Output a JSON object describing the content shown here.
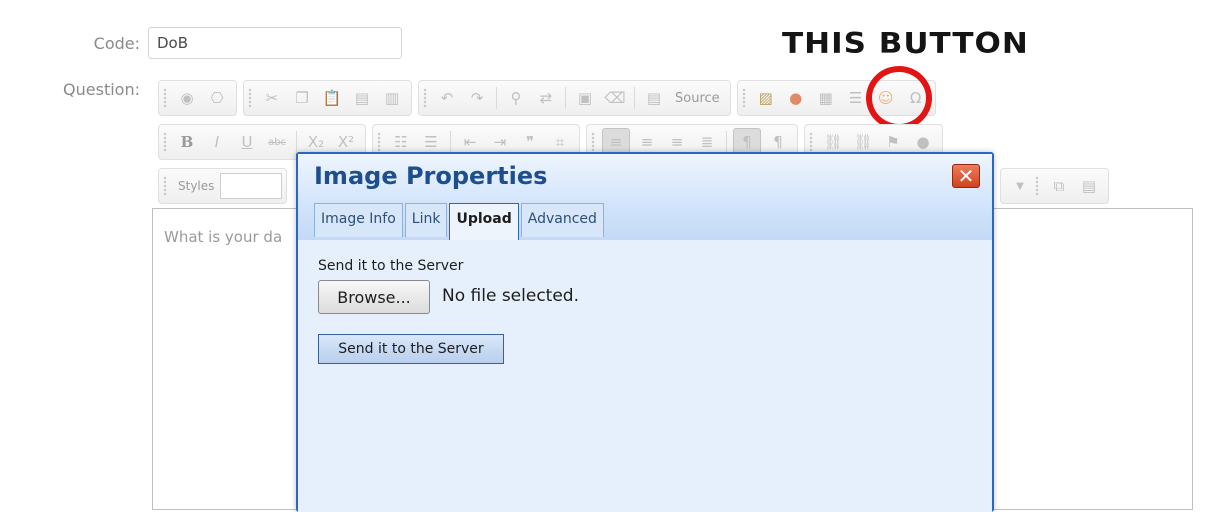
{
  "form": {
    "code_label": "Code:",
    "code_value": "DoB",
    "question_label": "Question:"
  },
  "annotation": {
    "text": "THIS BUTTON",
    "highlight_color": "#e21414"
  },
  "toolbar": {
    "source_label": "Source",
    "bold_label": "B",
    "italic_label": "I",
    "underline_label": "U",
    "strike_label": "abc",
    "subscript_label": "X₂",
    "superscript_label": "X²",
    "styles_label": "Styles"
  },
  "editor": {
    "text": "What is your da"
  },
  "dialog": {
    "title": "Image Properties",
    "tabs": [
      "Image Info",
      "Link",
      "Upload",
      "Advanced"
    ],
    "active_tab": "Upload",
    "upload": {
      "section_label": "Send it to the Server",
      "browse_label": "Browse...",
      "file_status": "No file selected.",
      "send_button_label": "Send it to the Server"
    },
    "accent_color": "#2a67c4"
  }
}
